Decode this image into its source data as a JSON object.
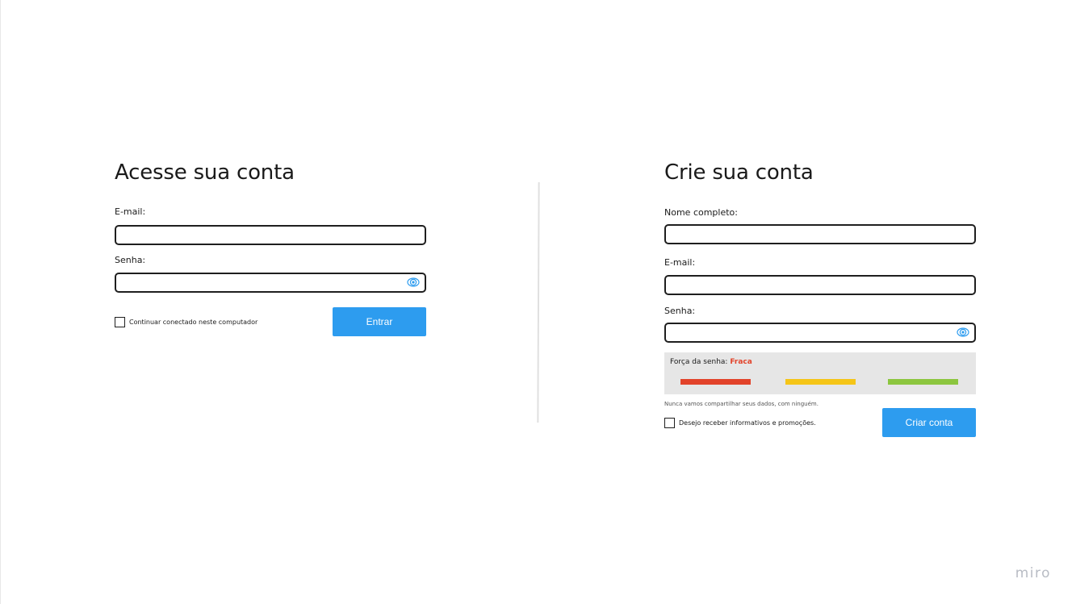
{
  "login": {
    "title": "Acesse sua conta",
    "email_label": "E-mail:",
    "email_value": "",
    "password_label": "Senha:",
    "password_value": "",
    "remember_label": "Continuar conectado neste computador",
    "remember_checked": false,
    "submit_label": "Entrar"
  },
  "signup": {
    "title": "Crie sua conta",
    "name_label": "Nome completo:",
    "name_value": "",
    "email_label": "E-mail:",
    "email_value": "",
    "password_label": "Senha:",
    "password_value": "",
    "strength_label": "Força da senha:",
    "strength_value": "Fraca",
    "strength_colors": [
      "#e2432a",
      "#f5c518",
      "#8cc63f"
    ],
    "privacy_note": "Nunca vamos compartilhar seus dados, com ninguém.",
    "newsletter_label": "Desejo receber informativos e promoções.",
    "newsletter_checked": false,
    "submit_label": "Criar conta"
  },
  "icons": {
    "password_toggle": "eye-icon"
  },
  "colors": {
    "accent": "#2d9cef",
    "weak": "#e2432a",
    "medium": "#f5c518",
    "strong": "#8cc63f"
  },
  "brand": {
    "watermark": "miro"
  }
}
